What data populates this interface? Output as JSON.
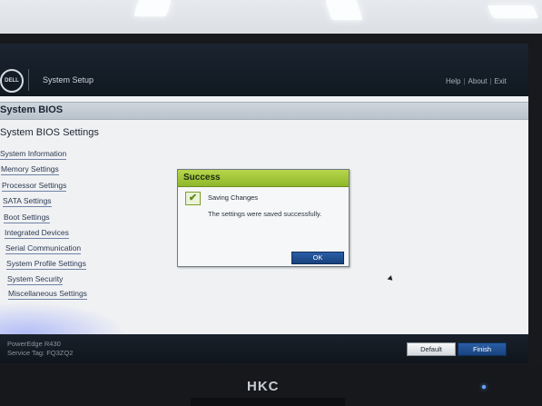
{
  "monitor": {
    "brand": "HKC"
  },
  "topbar": {
    "logo": "DELL",
    "title": "System Setup",
    "links": [
      "Help",
      "About",
      "Exit"
    ]
  },
  "bios": {
    "header": "System BIOS",
    "settings_heading": "System BIOS Settings",
    "menu": [
      "System Information",
      "Memory Settings",
      "Processor Settings",
      "SATA Settings",
      "Boot Settings",
      "Integrated Devices",
      "Serial Communication",
      "System Profile Settings",
      "System Security",
      "Miscellaneous Settings"
    ]
  },
  "dialog": {
    "title": "Success",
    "heading": "Saving Changes",
    "message": "The settings were saved successfully.",
    "ok_label": "OK",
    "icon": "checkmark-icon"
  },
  "bottombar": {
    "model": "PowerEdge R430",
    "service_tag": "Service Tag: FQ3ZQ2",
    "default_label": "Default",
    "finish_label": "Finish"
  },
  "colors": {
    "success_green": "#9fc23a",
    "button_blue": "#1f4f93",
    "header_gray": "#c4cdd6"
  }
}
